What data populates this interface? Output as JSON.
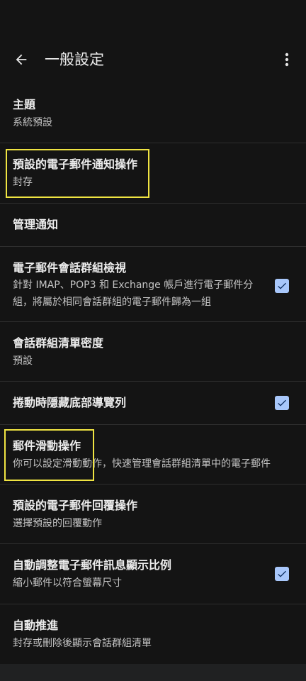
{
  "header": {
    "title": "一般設定",
    "back_icon": "arrow-back-icon",
    "menu_icon": "more-vert-icon"
  },
  "colors": {
    "background": "#141414",
    "checkbox": "#a8c7fa",
    "highlight_box": "#f0e442",
    "divider": "#2e2e2e"
  },
  "settings": [
    {
      "title": "主題",
      "subtitle": "系統預設"
    },
    {
      "title": "預設的電子郵件通知操作",
      "subtitle": "封存"
    },
    {
      "title": "管理通知"
    },
    {
      "title": "電子郵件會話群組檢視",
      "subtitle": "針對 IMAP、POP3 和 Exchange 帳戶進行電子郵件分組，將屬於相同會話群組的電子郵件歸為一組",
      "checked": true
    },
    {
      "title": "會話群組清單密度",
      "subtitle": "預設"
    },
    {
      "title": "捲動時隱藏底部導覽列",
      "checked": true
    },
    {
      "title": "郵件滑動操作",
      "subtitle": "你可以設定滑動動作，快速管理會話群組清單中的電子郵件"
    },
    {
      "title": "預設的電子郵件回覆操作",
      "subtitle": "選擇預設的回覆動作"
    },
    {
      "title": "自動調整電子郵件訊息顯示比例",
      "subtitle": "縮小郵件以符合螢幕尺寸",
      "checked": true
    },
    {
      "title": "自動推進",
      "subtitle": "封存或刪除後顯示會話群組清單"
    }
  ]
}
